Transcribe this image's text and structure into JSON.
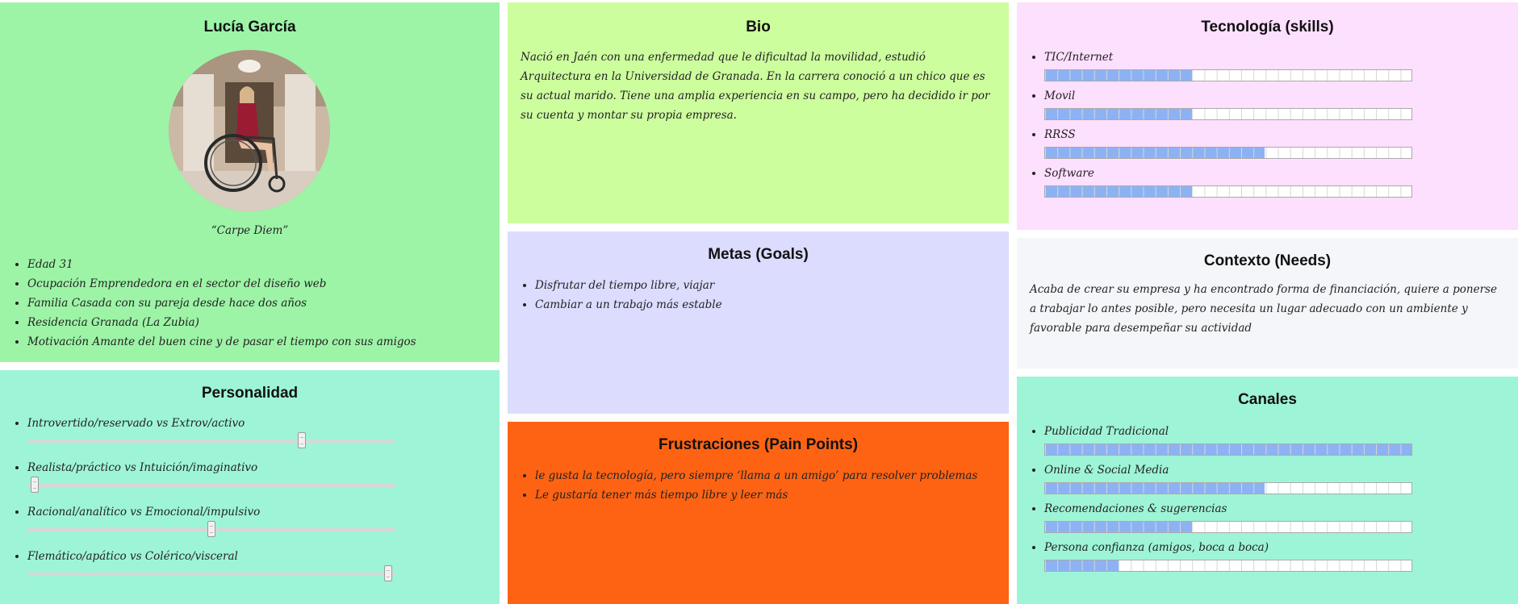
{
  "colors": {
    "bar_fill": "#8db2f4",
    "profile_bg": "#9df4a6",
    "personality_bg": "#9ef4d6",
    "bio_bg": "#cdfe9e",
    "goals_bg": "#dbdcfe",
    "frustrations_bg": "#fe6313",
    "technology_bg": "#fddffe",
    "context_bg": "#f4f6f9",
    "channels_bg": "#9ef4d6"
  },
  "profile": {
    "name": "Lucía García",
    "photo_icon": "person-in-wheelchair-photo",
    "motto": "“Carpe Diem”",
    "details": [
      "Edad 31",
      "Ocupación Emprendedora en el sector del diseño web",
      "Familia Casada con su pareja desde hace dos años",
      "Residencia Granada (La Zubia)",
      "Motivación Amante del buen cine y de pasar el tiempo con sus amigos"
    ]
  },
  "personality": {
    "title": "Personalidad",
    "traits": [
      {
        "label": "Introvertido/reservado vs Extrov/activo",
        "value": 0.75
      },
      {
        "label": "Realista/práctico vs Intuición/imaginativo",
        "value": 0.01
      },
      {
        "label": "Racional/analítico vs Emocional/impulsivo",
        "value": 0.5
      },
      {
        "label": "Flemático/apático vs Colérico/visceral",
        "value": 0.99
      }
    ]
  },
  "bio": {
    "title": "Bio",
    "text": "Nació en Jaén con una enfermedad que le dificultad la movilidad, estudió Arquitectura en la Universidad de Granada. En la carrera conoció a un chico que es su actual marido. Tiene una amplia experiencia en su campo, pero ha decidido ir por su cuenta y montar su propia empresa."
  },
  "goals": {
    "title": "Metas (Goals)",
    "items": [
      "Disfrutar del tiempo libre, viajar",
      "Cambiar a un trabajo más estable"
    ]
  },
  "frustrations": {
    "title": "Frustraciones (Pain Points)",
    "items": [
      "le gusta la tecnología, pero siempre ‘llama a un amigo’ para resolver problemas",
      "Le gustaría tener más tiempo libre y leer más"
    ]
  },
  "technology": {
    "title": "Tecnología (skills)",
    "skills": [
      {
        "label": "TIC/Internet",
        "value": 0.4
      },
      {
        "label": "Movil",
        "value": 0.4
      },
      {
        "label": "RRSS",
        "value": 0.6
      },
      {
        "label": "Software",
        "value": 0.4
      }
    ]
  },
  "context": {
    "title": "Contexto (Needs)",
    "text": "Acaba de crear su empresa y ha encontrado forma de financiación, quiere a ponerse a trabajar lo antes posible, pero necesita un lugar adecuado con un ambiente y favorable para desempeñar su actividad"
  },
  "channels": {
    "title": "Canales",
    "items": [
      {
        "label": "Publicidad Tradicional",
        "value": 1.0
      },
      {
        "label": "Online & Social Media",
        "value": 0.6
      },
      {
        "label": "Recomendaciones & sugerencias",
        "value": 0.4
      },
      {
        "label": "Persona confianza (amigos, boca a boca)",
        "value": 0.2
      }
    ]
  }
}
